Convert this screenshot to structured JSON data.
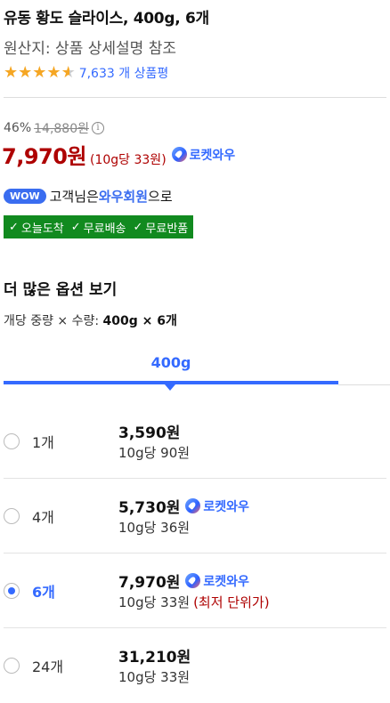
{
  "product": {
    "title": "유동 황도 슬라이스, 400g, 6개",
    "origin": "원산지: 상품 상세설명 참조",
    "rating": 4.5,
    "review_count": "7,633 개 상품평"
  },
  "pricing": {
    "discount": "46%",
    "original_price": "14,880원",
    "info_icon": "ⓘ",
    "price": "7,970원",
    "unit_price": "(10g당 33원)",
    "badge_label": "로켓와우"
  },
  "wow": {
    "pill": "WOW",
    "prefix": "고객님은 ",
    "member": "와우회원",
    "suffix": "으로"
  },
  "benefits": [
    "오늘도착",
    "무료배송",
    "무료반품"
  ],
  "more_options": {
    "title": "더 많은 옵션 보기",
    "desc_prefix": "개당 중량 × 수량: ",
    "desc_value": "400g × 6개"
  },
  "tab": {
    "label": "400g"
  },
  "options": [
    {
      "count": "1개",
      "price": "3,590원",
      "unit": "10g당 90원",
      "badge": "",
      "note": "",
      "selected": false
    },
    {
      "count": "4개",
      "price": "5,730원",
      "unit": "10g당 36원",
      "badge": "로켓와우",
      "note": "",
      "selected": false
    },
    {
      "count": "6개",
      "price": "7,970원",
      "unit": "10g당 33원",
      "badge": "로켓와우",
      "note": "(최저 단위가)",
      "selected": true
    },
    {
      "count": "24개",
      "price": "31,210원",
      "unit": "10g당 33원",
      "badge": "",
      "note": "",
      "selected": false
    }
  ],
  "colors": {
    "accent": "#346aff",
    "price_red": "#ae0000",
    "benefit_green": "#118a1f",
    "star": "#f5a623"
  }
}
